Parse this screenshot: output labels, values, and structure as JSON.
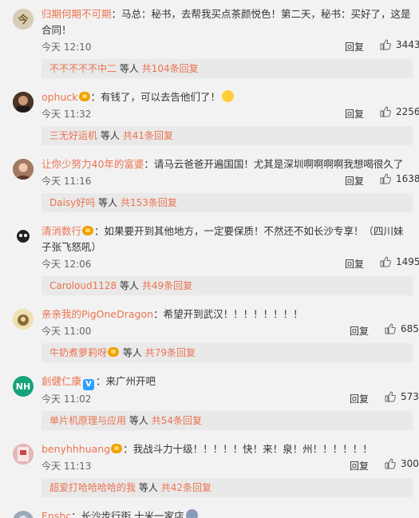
{
  "reply_label": "回复",
  "others_label": "等人",
  "comments": [
    {
      "username": "归期何期不可期",
      "text": "：马总：秘书，去帮我买点茶颜悦色！第二天，秘书：买好了，这是合同！",
      "time": "今天 12:10",
      "likes": "3443",
      "replies": {
        "names": "不不不不不中二",
        "total": "共104条回复"
      }
    },
    {
      "username": "ophuck",
      "text": "：有钱了，可以去告他们了！",
      "time": "今天 11:32",
      "likes": "2256",
      "replies": {
        "names": "三无好运机",
        "total": "共41条回复"
      }
    },
    {
      "username": "让你少努力40年的富婆",
      "text": "：请马云爸爸开遍国国！尤其是深圳啊啊啊啊我想喝很久了",
      "time": "今天 11:16",
      "likes": "1638",
      "replies": {
        "names": "Daisy好吗",
        "total": "共153条回复"
      }
    },
    {
      "username": "清消数行",
      "text": "：如果要开到其他地方，一定要保质！不然还不如长沙专享！（四川妹子张飞怒吼）",
      "time": "今天 12:06",
      "likes": "1495",
      "replies": {
        "names": "Caroloud1128",
        "total": "共49条回复"
      }
    },
    {
      "username": "亲亲我的PigOneDragon",
      "text": "：希望开到武汉！！！！！！！！",
      "time": "今天 11:00",
      "likes": "685",
      "replies": {
        "names": "牛奶煮萝莉呀",
        "total": "共79条回复"
      }
    },
    {
      "username": "創健仁康",
      "avatar_text": "NH",
      "text": "：来广州开吧",
      "time": "今天 11:02",
      "likes": "573",
      "replies": {
        "names": "单片机原理与应用",
        "total": "共54条回复"
      }
    },
    {
      "username": "benyhhhuang",
      "text": "：我战斗力十级！！！！！快！来！泉！州！！！！！！",
      "time": "今天 11:13",
      "likes": "300",
      "replies": {
        "names": "超爱打哈哈哈哈的我",
        "total": "共42条回复"
      }
    },
    {
      "username": "Enshc",
      "text": "：长沙步行街 十米一家店",
      "time": "",
      "likes": "",
      "replies": null
    }
  ],
  "colors": {
    "link": "#eb7350",
    "text": "#333333",
    "background": "#f2f2f2",
    "subbox": "#e9e9e9"
  },
  "icons": {
    "like": "thumbs-up-icon",
    "badge": "crown-badge-icon",
    "verified": "verified-v-icon"
  }
}
